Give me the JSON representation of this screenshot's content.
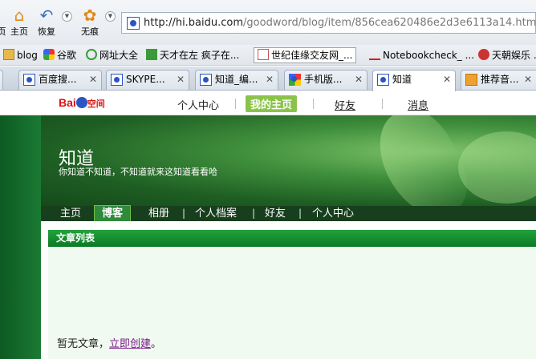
{
  "browser": {
    "nav": {
      "home_label": "主页",
      "back_label": "恢复",
      "noscript_label": "无痕",
      "partial_left_label": "页"
    },
    "address": {
      "url_host": "http://hi.baidu.com",
      "url_path": "/goodword/blog/item/856cea620486e2d3e6113a14.html"
    },
    "bookmarks": [
      {
        "label": "blog",
        "icon": "folder-icon"
      },
      {
        "label": "谷歌",
        "icon": "google-icon"
      },
      {
        "label": "网址大全",
        "icon": "ie-icon"
      },
      {
        "label": "天才在左 疯子在...",
        "icon": "green-e-icon"
      },
      {
        "label": "世纪佳缘交友网_...",
        "icon": "jiayuan-icon"
      },
      {
        "label": "Notebookcheck_ ...",
        "icon": "notebookcheck-icon"
      },
      {
        "label": "天朝娱乐 ...",
        "icon": "tianchao-icon"
      }
    ],
    "tabs": [
      {
        "label": "百度搜...",
        "icon": "baidu-paw-icon",
        "active": false
      },
      {
        "label": "SKYPE...",
        "icon": "baidu-paw-icon",
        "active": false
      },
      {
        "label": "知道_编...",
        "icon": "baidu-paw-icon",
        "active": false
      },
      {
        "label": "手机版...",
        "icon": "google-icon",
        "active": false
      },
      {
        "label": "知道",
        "icon": "baidu-paw-icon",
        "active": true
      },
      {
        "label": "推荐音...",
        "icon": "st-icon",
        "active": false
      }
    ]
  },
  "site": {
    "logo_text": "Bai",
    "logo_suffix": "空间",
    "topnav": {
      "personal_center": "个人中心",
      "my_home": "我的主页",
      "friends": "好友",
      "messages": "消息"
    },
    "blog": {
      "title": "知道",
      "subtitle": "你知道不知道，不知道就来这知道看看哈"
    },
    "menu": [
      "主页",
      "博客",
      "相册",
      "个人档案",
      "好友",
      "个人中心"
    ],
    "menu_active_index": 1,
    "menu_separator": "|",
    "panel": {
      "title": "文章列表",
      "empty_text": "暂无文章，",
      "create_link": "立即创建",
      "end_punct": "。"
    }
  },
  "colors": {
    "accent_green": "#0d7a26",
    "menu_dark": "#173f1d",
    "link_purple": "#7a1a8a",
    "baidu_blue": "#2a55c4",
    "baidu_red": "#dd1111"
  }
}
